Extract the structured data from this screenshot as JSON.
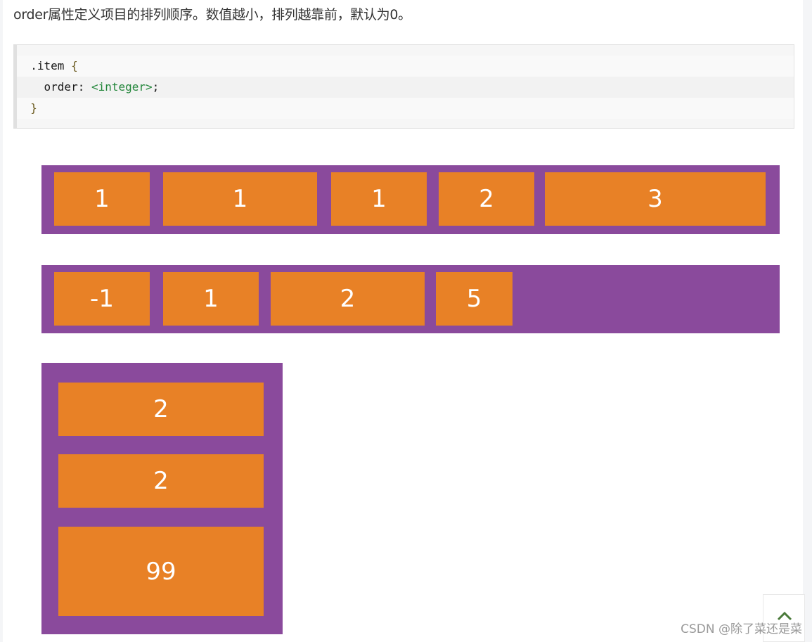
{
  "article": {
    "intro": "order属性定义项目的排列顺序。数值越小，排列越靠前，默认为0。",
    "code": {
      "selector": ".item",
      "open_brace": "{",
      "property": "order",
      "colon": ": ",
      "value": "<integer>",
      "semicolon": ";",
      "close_brace": "}"
    }
  },
  "figure": {
    "row1": [
      "1",
      "1",
      "1",
      "2",
      "3"
    ],
    "row2": [
      "-1",
      "1",
      "2",
      "5"
    ],
    "column": [
      "2",
      "2",
      "99"
    ],
    "colors": {
      "container": "#8a4a9c",
      "item": "#e88126"
    }
  },
  "footer": {
    "watermark": "CSDN @除了菜还是菜",
    "back_to_top_icon": "chevron-up-icon"
  }
}
